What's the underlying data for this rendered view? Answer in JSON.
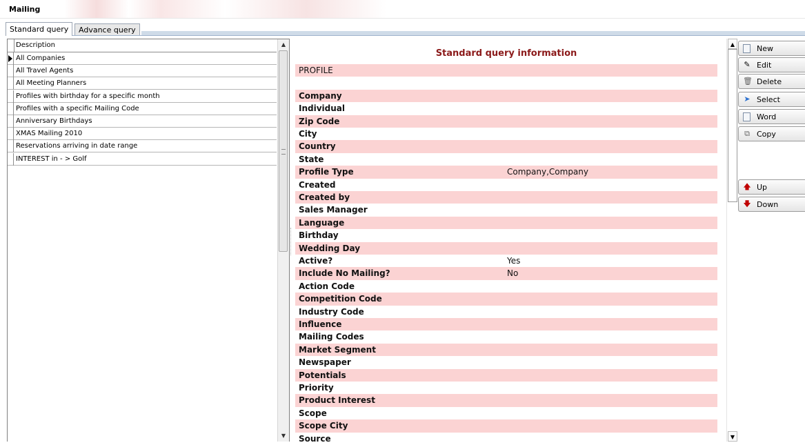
{
  "window": {
    "title": "Mailing"
  },
  "tabs": [
    {
      "label": "Standard query",
      "active": true
    },
    {
      "label": "Advance query",
      "active": false
    }
  ],
  "grid": {
    "header": "Description",
    "rows": [
      "All Companies",
      "All Travel Agents",
      "All Meeting Planners",
      "Profiles with birthday for a specific month",
      "Profiles with a specific Mailing Code",
      "Anniversary Birthdays",
      "XMAS Mailing 2010",
      "Reservations arriving in date range",
      "INTEREST in  - > Golf"
    ],
    "selected_index": 0
  },
  "info": {
    "title": "Standard query information",
    "section": "PROFILE",
    "fields": [
      {
        "label": "Company",
        "value": ""
      },
      {
        "label": "Individual",
        "value": ""
      },
      {
        "label": "Zip Code",
        "value": ""
      },
      {
        "label": "City",
        "value": ""
      },
      {
        "label": "Country",
        "value": ""
      },
      {
        "label": "State",
        "value": ""
      },
      {
        "label": "Profile Type",
        "value": "Company,Company"
      },
      {
        "label": "Created",
        "value": ""
      },
      {
        "label": "Created by",
        "value": ""
      },
      {
        "label": "Sales Manager",
        "value": ""
      },
      {
        "label": "Language",
        "value": ""
      },
      {
        "label": "Birthday",
        "value": ""
      },
      {
        "label": "Wedding Day",
        "value": ""
      },
      {
        "label": "Active?",
        "value": "Yes"
      },
      {
        "label": "Include No Mailing?",
        "value": "No"
      },
      {
        "label": "Action Code",
        "value": ""
      },
      {
        "label": "Competition Code",
        "value": ""
      },
      {
        "label": "Industry Code",
        "value": ""
      },
      {
        "label": "Influence",
        "value": ""
      },
      {
        "label": "Mailing Codes",
        "value": ""
      },
      {
        "label": "Market Segment",
        "value": ""
      },
      {
        "label": "Newspaper",
        "value": ""
      },
      {
        "label": "Potentials",
        "value": ""
      },
      {
        "label": "Priority",
        "value": ""
      },
      {
        "label": "Product Interest",
        "value": ""
      },
      {
        "label": "Scope",
        "value": ""
      },
      {
        "label": "Scope City",
        "value": ""
      },
      {
        "label": "Source",
        "value": ""
      }
    ]
  },
  "toolbar": {
    "new": "New",
    "edit": "Edit",
    "delete": "Delete",
    "select": "Select",
    "word": "Word",
    "copy": "Copy",
    "up": "Up",
    "down": "Down"
  },
  "colors": {
    "title": "#8b1a1a",
    "stripe": "#fbd3d3",
    "arrow_red": "#c00000"
  }
}
